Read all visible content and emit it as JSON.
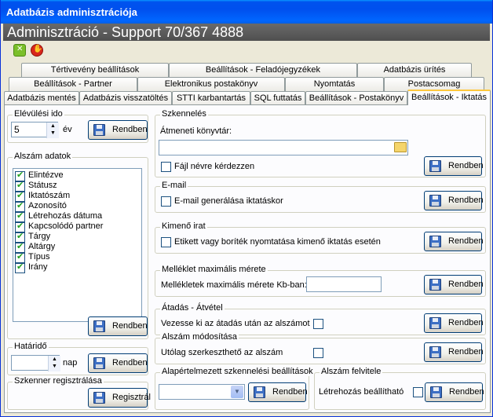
{
  "window": {
    "title": "Adatbázis adminisztrációja"
  },
  "banner": {
    "text": "Adminisztráció - Support 70/367 4888"
  },
  "tabs": {
    "row1": [
      "Tértivevény beállítások",
      "Beállítások - Feladójegyzékek",
      "Adatbázis ürítés"
    ],
    "row2": [
      "Beállítások - Partner",
      "Elektronikus postakönyv",
      "Nyomtatás",
      "Postacsomag"
    ],
    "row3": [
      "Adatbázis mentés",
      "Adatbázis visszatöltés",
      "STTI karbantartás",
      "SQL futtatás",
      "Beállítások - Postakönyv",
      "Beállítások - Iktatás"
    ]
  },
  "save_label": "Rendben",
  "elevulesi": {
    "title": "Elévülési ido",
    "value": "5",
    "unit": "év"
  },
  "alszam": {
    "title": "Alszám adatok",
    "items": [
      "Elintézve",
      "Státusz",
      "Iktatószám",
      "Azonosító",
      "Létrehozás dátuma",
      "Kapcsolódó partner",
      "Tárgy",
      "Altárgy",
      "Típus",
      "Irány"
    ]
  },
  "hatarido": {
    "title": "Határidő",
    "value": "",
    "unit": "nap"
  },
  "szkenner_reg": {
    "title": "Szkenner regisztrálása",
    "button": "Regisztrál"
  },
  "szkenneles": {
    "title": "Szkennelés",
    "label": "Átmeneti könyvtár:",
    "value": "",
    "checkbox": "Fájl névre kérdezzen"
  },
  "email": {
    "title": "E-mail",
    "checkbox": "E-mail generálása iktatáskor"
  },
  "kimeno": {
    "title": "Kimenő irat",
    "checkbox": "Etikett vagy boríték nyomtatása kimenő iktatás esetén"
  },
  "melleklet": {
    "title": "Melléklet maximális mérete",
    "label": "Mellékletek maximális mérete Kb-ban:",
    "value": ""
  },
  "atadas": {
    "title": "Átadás - Átvétel",
    "label": "Vezesse ki az átadás után az alszámot"
  },
  "alszam_mod": {
    "title": "Alszám módosítása",
    "label": "Utólag szerkeszthető az alszám"
  },
  "alapert": {
    "title": "Alapértelmezett szkennelési beállítások",
    "value": ""
  },
  "felvitel": {
    "title": "Alszám felvitele",
    "label": "Létrehozás beállítható"
  }
}
